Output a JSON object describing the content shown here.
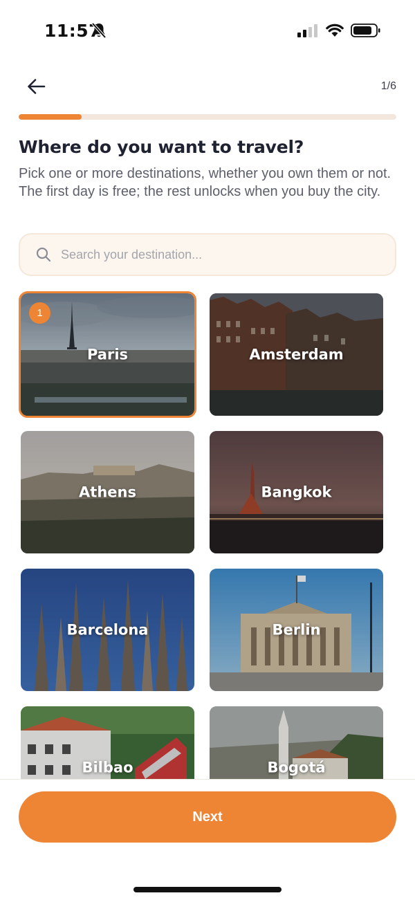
{
  "status_bar": {
    "time": "11:57"
  },
  "header": {
    "step_counter": "1/6",
    "progress": 0.167
  },
  "title": "Where do you want to travel?",
  "subtitle": "Pick one or more destinations, whether you own them or not. The first day is free; the rest unlocks when you buy the city.",
  "search": {
    "placeholder": "Search your destination...",
    "value": ""
  },
  "destinations": [
    {
      "name": "Paris",
      "selected": true,
      "order": "1"
    },
    {
      "name": "Amsterdam",
      "selected": false
    },
    {
      "name": "Athens",
      "selected": false
    },
    {
      "name": "Bangkok",
      "selected": false
    },
    {
      "name": "Barcelona",
      "selected": false
    },
    {
      "name": "Berlin",
      "selected": false
    },
    {
      "name": "Bilbao",
      "selected": false
    },
    {
      "name": "Bogotá",
      "selected": false
    }
  ],
  "next_button": {
    "label": "Next"
  },
  "colors": {
    "accent": "#ee8535",
    "progress_track": "#f3e6dc",
    "search_bg": "#fdf6ef"
  },
  "icons": [
    "bell-slash-icon",
    "cellular-signal-icon",
    "wifi-icon",
    "battery-icon",
    "back-arrow-icon",
    "search-icon"
  ]
}
